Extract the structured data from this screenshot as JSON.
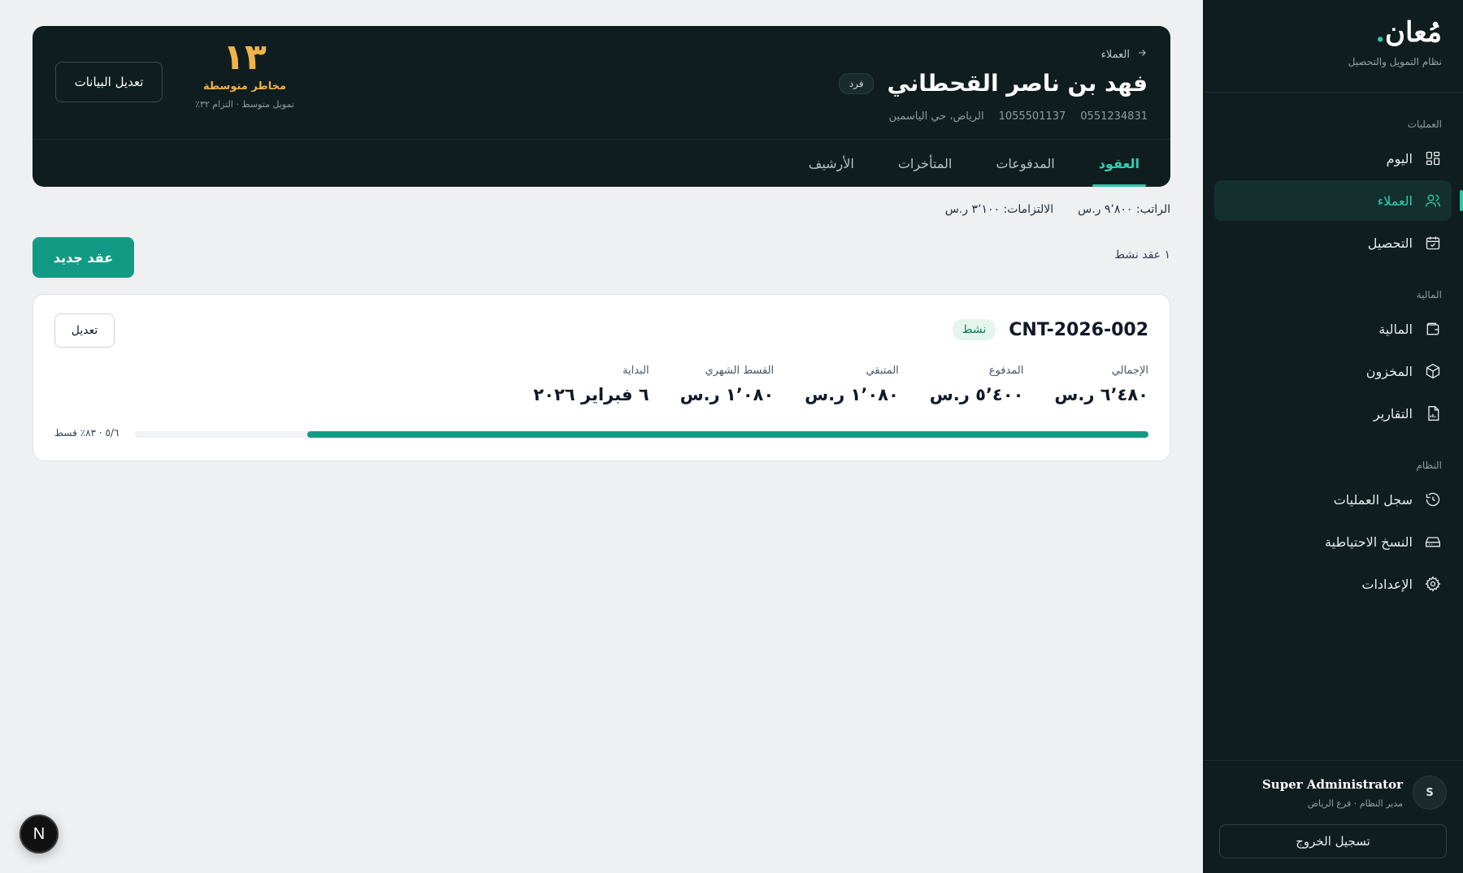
{
  "brand": {
    "name": "مُعان",
    "dot": ".",
    "tagline": "نظام التمويل والتحصيل"
  },
  "sidebar": {
    "groups": [
      {
        "label": "العمليات",
        "items": [
          {
            "label": "اليوم",
            "icon": "dashboard-icon"
          },
          {
            "label": "العملاء",
            "icon": "users-icon",
            "active": true
          },
          {
            "label": "التحصيل",
            "icon": "calendar-check-icon"
          }
        ]
      },
      {
        "label": "المالية",
        "items": [
          {
            "label": "المالية",
            "icon": "wallet-icon"
          },
          {
            "label": "المخزون",
            "icon": "box-icon"
          },
          {
            "label": "التقارير",
            "icon": "report-icon"
          }
        ]
      },
      {
        "label": "النظام",
        "items": [
          {
            "label": "سجل العمليات",
            "icon": "history-icon"
          },
          {
            "label": "النسخ الاحتياطية",
            "icon": "drive-icon"
          },
          {
            "label": "الإعدادات",
            "icon": "gear-icon"
          }
        ]
      }
    ],
    "user": {
      "initial": "S",
      "name": "Super Administrator",
      "role": "مدير النظام · فرع الرياض"
    },
    "logout_label": "تسجيل الخروج"
  },
  "header": {
    "breadcrumb": "العملاء",
    "client_name": "فهد بن ناصر القحطاني",
    "client_type": "فرد",
    "phone": "0551234831",
    "national_id": "1055501137",
    "address": "الرياض، حي الياسمين",
    "risk": {
      "score": "١٣",
      "label": "مخاطر متوسطة",
      "sub": "تمويل متوسط · التزام ٣٢٪"
    },
    "edit_data_label": "تعديل البيانات",
    "tabs": [
      {
        "label": "العقود",
        "active": true
      },
      {
        "label": "المدفوعات",
        "active": false
      },
      {
        "label": "المتأخرات",
        "active": false
      },
      {
        "label": "الأرشيف",
        "active": false
      }
    ]
  },
  "finance": {
    "salary_label": "الراتب:",
    "salary_value": "٩٬٨٠٠ ر.س",
    "obligations_label": "الالتزامات:",
    "obligations_value": "٣٬١٠٠ ر.س"
  },
  "contracts_summary": {
    "active_count": "١ عقد نشط",
    "new_contract_label": "عقد جديد"
  },
  "contract": {
    "id": "CNT-2026-002",
    "status": "نشط",
    "edit_label": "تعديل",
    "stats": [
      {
        "label": "الإجمالي",
        "value": "٦٬٤٨٠ ر.س"
      },
      {
        "label": "المدفوع",
        "value": "٥٬٤٠٠ ر.س"
      },
      {
        "label": "المتبقي",
        "value": "١٬٠٨٠ ر.س"
      },
      {
        "label": "القسط الشهري",
        "value": "١٬٠٨٠ ر.س"
      },
      {
        "label": "البداية",
        "value": "٦ فبراير ٢٠٢٦"
      }
    ],
    "progress_percent": 83,
    "progress_text": "٥/٦ · ٨٣٪ قسط"
  },
  "dev_badge": "N",
  "colors": {
    "accent": "#139a84",
    "sidebar_bg": "#0f1d1f",
    "risk": "#f0b34a",
    "active_nav": "#2fd1b0"
  }
}
